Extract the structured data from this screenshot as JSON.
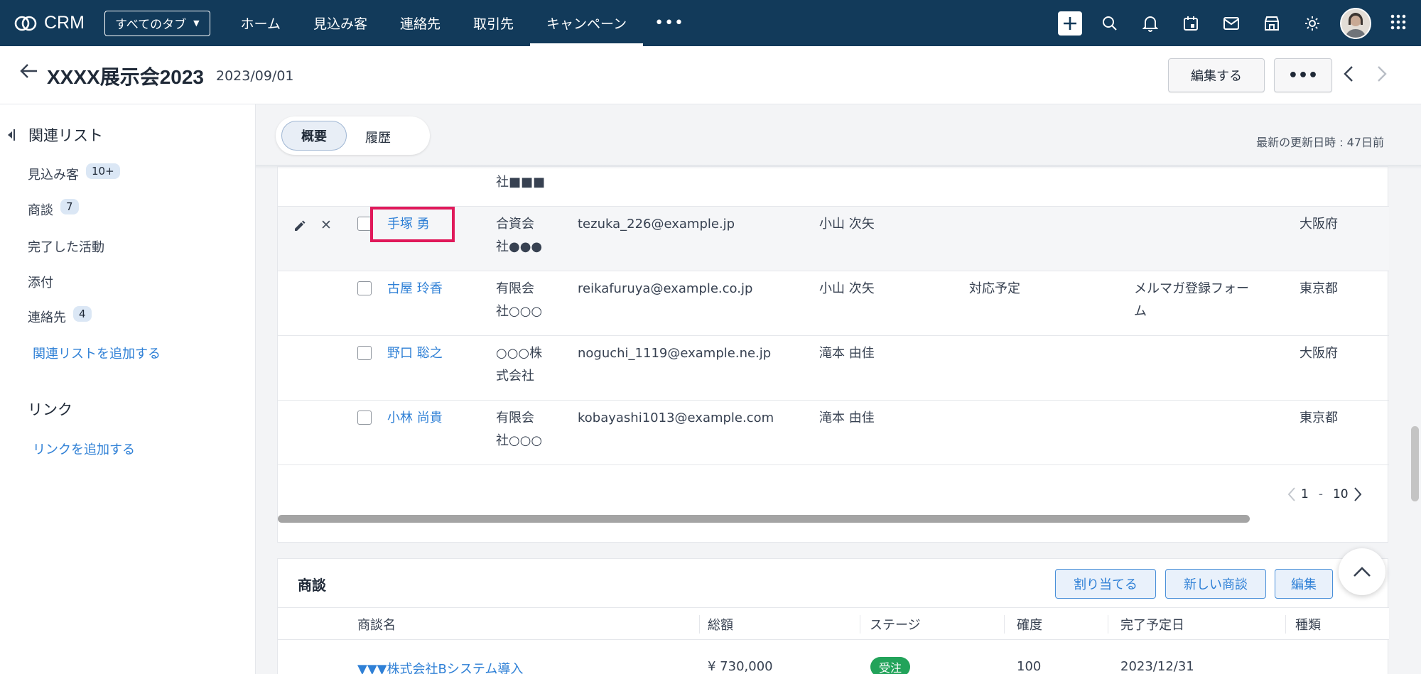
{
  "topnav": {
    "app_name": "CRM",
    "all_tabs_label": "すべてのタブ",
    "tabs": [
      "ホーム",
      "見込み客",
      "連絡先",
      "取引先",
      "キャンペーン"
    ],
    "active_tab": "キャンペーン",
    "more_label": "•••"
  },
  "record": {
    "title": "XXXX展示会2023",
    "date": "2023/09/01",
    "edit_label": "編集する",
    "more_label": "•••"
  },
  "sidebar": {
    "heading": "関連リスト",
    "items": [
      {
        "label": "見込み客",
        "badge": "10+"
      },
      {
        "label": "商談",
        "badge": "7"
      },
      {
        "label": "完了した活動",
        "badge": ""
      },
      {
        "label": "添付",
        "badge": ""
      },
      {
        "label": "連絡先",
        "badge": "4"
      }
    ],
    "add_related": "関連リストを追加する",
    "links_heading": "リンク",
    "add_link": "リンクを追加する"
  },
  "main": {
    "tab_overview": "概要",
    "tab_history": "履歴",
    "updated": "最新の更新日時 : 47日前"
  },
  "leads": {
    "partial_row": {
      "company_line2": "社■■■"
    },
    "rows": [
      {
        "name": "手塚 勇",
        "company1": "合資会",
        "company2": "社●●●",
        "email": "tezuka_226@example.jp",
        "owner": "小山 次矢",
        "status": "",
        "source1": "",
        "source2": "",
        "pref": "大阪府"
      },
      {
        "name": "古屋 玲香",
        "company1": "有限会",
        "company2": "社○○○",
        "email": "reikafuruya@example.co.jp",
        "owner": "小山 次矢",
        "status": "対応予定",
        "source1": "メルマガ登録フォー",
        "source2": "ム",
        "pref": "東京都"
      },
      {
        "name": "野口 聡之",
        "company1": "○○○株",
        "company2": "式会社",
        "email": "noguchi_1119@example.ne.jp",
        "owner": "滝本 由佳",
        "status": "",
        "source1": "",
        "source2": "",
        "pref": "大阪府"
      },
      {
        "name": "小林 尚貴",
        "company1": "有限会",
        "company2": "社○○○",
        "email": "kobayashi1013@example.com",
        "owner": "滝本 由佳",
        "status": "",
        "source1": "",
        "source2": "",
        "pref": "東京都"
      }
    ],
    "pager": {
      "from": "1",
      "dash": "-",
      "to": "10"
    }
  },
  "deals": {
    "title": "商談",
    "buttons": {
      "assign": "割り当てる",
      "new": "新しい商談",
      "edit": "編集"
    },
    "columns": [
      "商談名",
      "総額",
      "ステージ",
      "確度",
      "完了予定日",
      "種類"
    ],
    "row": {
      "name": "▼▼▼株式会社Bシステム導入",
      "amount": "¥ 730,000",
      "stage": "受注",
      "probability": "100",
      "close_date": "2023/12/31"
    }
  },
  "colors": {
    "nav": "#123a5a",
    "link": "#2f80d6",
    "highlight": "#e0195a",
    "stage_won": "#22a35a"
  }
}
